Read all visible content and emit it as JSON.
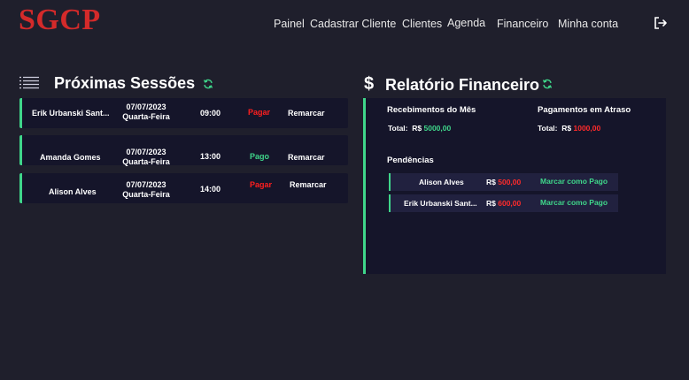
{
  "brand": {
    "logo": "SGCP"
  },
  "nav": {
    "painel": "Painel",
    "cadastrar": "Cadastrar Cliente",
    "clientes": "Clientes",
    "agenda": "Agenda",
    "financeiro": "Financeiro",
    "minha_conta": "Minha conta"
  },
  "sessions": {
    "title": "Próximas Sessões",
    "items": [
      {
        "name": "Erik Urbanski Sant...",
        "date": "07/07/2023",
        "weekday": "Quarta-Feira",
        "time": "09:00",
        "status": "Pagar",
        "action": "Remarcar"
      },
      {
        "name": "Amanda Gomes",
        "date": "07/07/2023",
        "weekday": "Quarta-Feira",
        "time": "13:00",
        "status": "Pago",
        "action": "Remarcar"
      },
      {
        "name": "Alison Alves",
        "date": "07/07/2023",
        "weekday": "Quarta-Feira",
        "time": "14:00",
        "status": "Pagar",
        "action": "Remarcar"
      }
    ]
  },
  "finance": {
    "dollar": "$",
    "title": "Relatório Financeiro",
    "receipts_title": "Recebimentos do Mês",
    "receipts_label": "Total:",
    "receipts_currency": "R$",
    "receipts_value": "5000,00",
    "overdue_title": "Pagamentos em Atraso",
    "overdue_label": "Total:",
    "overdue_currency": "R$",
    "overdue_value": "1000,00",
    "pending_title": "Pendências",
    "pending": [
      {
        "name": "Alison Alves",
        "currency": "R$",
        "value": "500,00",
        "action": "Marcar como Pago"
      },
      {
        "name": "Erik Urbanski Sant...",
        "currency": "R$",
        "value": "600,00",
        "action": "Marcar como Pago"
      }
    ]
  },
  "colors": {
    "background": "#1f1f2c",
    "card": "#15152a",
    "accent": "#3fd68a",
    "danger": "#ff1f1f",
    "logo": "#d42a2a"
  },
  "icons": {
    "list": "list-icon",
    "refresh": "refresh-icon",
    "logout": "logout-icon"
  }
}
